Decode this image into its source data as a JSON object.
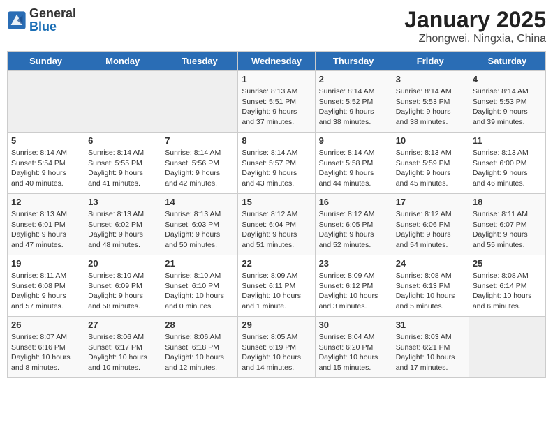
{
  "header": {
    "logo_general": "General",
    "logo_blue": "Blue",
    "title": "January 2025",
    "subtitle": "Zhongwei, Ningxia, China"
  },
  "weekdays": [
    "Sunday",
    "Monday",
    "Tuesday",
    "Wednesday",
    "Thursday",
    "Friday",
    "Saturday"
  ],
  "weeks": [
    [
      {
        "day": "",
        "info": ""
      },
      {
        "day": "",
        "info": ""
      },
      {
        "day": "",
        "info": ""
      },
      {
        "day": "1",
        "info": "Sunrise: 8:13 AM\nSunset: 5:51 PM\nDaylight: 9 hours and 37 minutes."
      },
      {
        "day": "2",
        "info": "Sunrise: 8:14 AM\nSunset: 5:52 PM\nDaylight: 9 hours and 38 minutes."
      },
      {
        "day": "3",
        "info": "Sunrise: 8:14 AM\nSunset: 5:53 PM\nDaylight: 9 hours and 38 minutes."
      },
      {
        "day": "4",
        "info": "Sunrise: 8:14 AM\nSunset: 5:53 PM\nDaylight: 9 hours and 39 minutes."
      }
    ],
    [
      {
        "day": "5",
        "info": "Sunrise: 8:14 AM\nSunset: 5:54 PM\nDaylight: 9 hours and 40 minutes."
      },
      {
        "day": "6",
        "info": "Sunrise: 8:14 AM\nSunset: 5:55 PM\nDaylight: 9 hours and 41 minutes."
      },
      {
        "day": "7",
        "info": "Sunrise: 8:14 AM\nSunset: 5:56 PM\nDaylight: 9 hours and 42 minutes."
      },
      {
        "day": "8",
        "info": "Sunrise: 8:14 AM\nSunset: 5:57 PM\nDaylight: 9 hours and 43 minutes."
      },
      {
        "day": "9",
        "info": "Sunrise: 8:14 AM\nSunset: 5:58 PM\nDaylight: 9 hours and 44 minutes."
      },
      {
        "day": "10",
        "info": "Sunrise: 8:13 AM\nSunset: 5:59 PM\nDaylight: 9 hours and 45 minutes."
      },
      {
        "day": "11",
        "info": "Sunrise: 8:13 AM\nSunset: 6:00 PM\nDaylight: 9 hours and 46 minutes."
      }
    ],
    [
      {
        "day": "12",
        "info": "Sunrise: 8:13 AM\nSunset: 6:01 PM\nDaylight: 9 hours and 47 minutes."
      },
      {
        "day": "13",
        "info": "Sunrise: 8:13 AM\nSunset: 6:02 PM\nDaylight: 9 hours and 48 minutes."
      },
      {
        "day": "14",
        "info": "Sunrise: 8:13 AM\nSunset: 6:03 PM\nDaylight: 9 hours and 50 minutes."
      },
      {
        "day": "15",
        "info": "Sunrise: 8:12 AM\nSunset: 6:04 PM\nDaylight: 9 hours and 51 minutes."
      },
      {
        "day": "16",
        "info": "Sunrise: 8:12 AM\nSunset: 6:05 PM\nDaylight: 9 hours and 52 minutes."
      },
      {
        "day": "17",
        "info": "Sunrise: 8:12 AM\nSunset: 6:06 PM\nDaylight: 9 hours and 54 minutes."
      },
      {
        "day": "18",
        "info": "Sunrise: 8:11 AM\nSunset: 6:07 PM\nDaylight: 9 hours and 55 minutes."
      }
    ],
    [
      {
        "day": "19",
        "info": "Sunrise: 8:11 AM\nSunset: 6:08 PM\nDaylight: 9 hours and 57 minutes."
      },
      {
        "day": "20",
        "info": "Sunrise: 8:10 AM\nSunset: 6:09 PM\nDaylight: 9 hours and 58 minutes."
      },
      {
        "day": "21",
        "info": "Sunrise: 8:10 AM\nSunset: 6:10 PM\nDaylight: 10 hours and 0 minutes."
      },
      {
        "day": "22",
        "info": "Sunrise: 8:09 AM\nSunset: 6:11 PM\nDaylight: 10 hours and 1 minute."
      },
      {
        "day": "23",
        "info": "Sunrise: 8:09 AM\nSunset: 6:12 PM\nDaylight: 10 hours and 3 minutes."
      },
      {
        "day": "24",
        "info": "Sunrise: 8:08 AM\nSunset: 6:13 PM\nDaylight: 10 hours and 5 minutes."
      },
      {
        "day": "25",
        "info": "Sunrise: 8:08 AM\nSunset: 6:14 PM\nDaylight: 10 hours and 6 minutes."
      }
    ],
    [
      {
        "day": "26",
        "info": "Sunrise: 8:07 AM\nSunset: 6:16 PM\nDaylight: 10 hours and 8 minutes."
      },
      {
        "day": "27",
        "info": "Sunrise: 8:06 AM\nSunset: 6:17 PM\nDaylight: 10 hours and 10 minutes."
      },
      {
        "day": "28",
        "info": "Sunrise: 8:06 AM\nSunset: 6:18 PM\nDaylight: 10 hours and 12 minutes."
      },
      {
        "day": "29",
        "info": "Sunrise: 8:05 AM\nSunset: 6:19 PM\nDaylight: 10 hours and 14 minutes."
      },
      {
        "day": "30",
        "info": "Sunrise: 8:04 AM\nSunset: 6:20 PM\nDaylight: 10 hours and 15 minutes."
      },
      {
        "day": "31",
        "info": "Sunrise: 8:03 AM\nSunset: 6:21 PM\nDaylight: 10 hours and 17 minutes."
      },
      {
        "day": "",
        "info": ""
      }
    ]
  ]
}
